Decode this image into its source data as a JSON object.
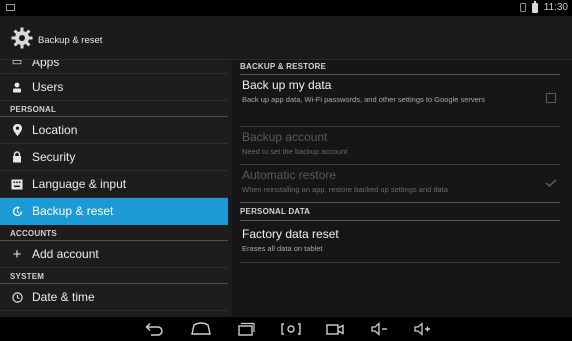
{
  "status_bar": {
    "time": "11:30"
  },
  "action_bar": {
    "title": "Backup & reset",
    "icon": "gear-icon"
  },
  "sidebar": {
    "items": [
      {
        "type": "item",
        "label": "Apps",
        "icon": "apps-icon"
      },
      {
        "type": "item",
        "label": "Users",
        "icon": "users-icon"
      },
      {
        "type": "header",
        "label": "PERSONAL"
      },
      {
        "type": "item",
        "label": "Location",
        "icon": "location-icon"
      },
      {
        "type": "item",
        "label": "Security",
        "icon": "lock-icon"
      },
      {
        "type": "item",
        "label": "Language & input",
        "icon": "keyboard-icon"
      },
      {
        "type": "item",
        "label": "Backup & reset",
        "icon": "backup-icon",
        "selected": true
      },
      {
        "type": "header",
        "label": "ACCOUNTS"
      },
      {
        "type": "item",
        "label": "Add account",
        "icon": "plus-icon"
      },
      {
        "type": "header",
        "label": "SYSTEM"
      },
      {
        "type": "item",
        "label": "Date & time",
        "icon": "clock-icon"
      }
    ]
  },
  "detail": {
    "section1": "BACKUP & RESTORE",
    "backup_data": {
      "title": "Back up my data",
      "summary": "Back up app data, Wi-Fi passwords, and other settings to Google servers",
      "checked": false
    },
    "backup_account": {
      "title": "Backup account",
      "summary": "Need to set the backup account",
      "enabled": false
    },
    "auto_restore": {
      "title": "Automatic restore",
      "summary": "When reinstalling an app, restore backed up settings and data",
      "checked": true,
      "enabled": false
    },
    "section2": "PERSONAL DATA",
    "factory_reset": {
      "title": "Factory data reset",
      "summary": "Erases all data on tablet"
    }
  },
  "nav_bar": {
    "buttons": [
      "back-icon",
      "home-icon",
      "recents-icon",
      "screenshot-icon",
      "camera-icon",
      "volume-down-icon",
      "volume-up-icon"
    ]
  },
  "colors": {
    "accent": "#1b9ad6",
    "background": "#161616"
  }
}
